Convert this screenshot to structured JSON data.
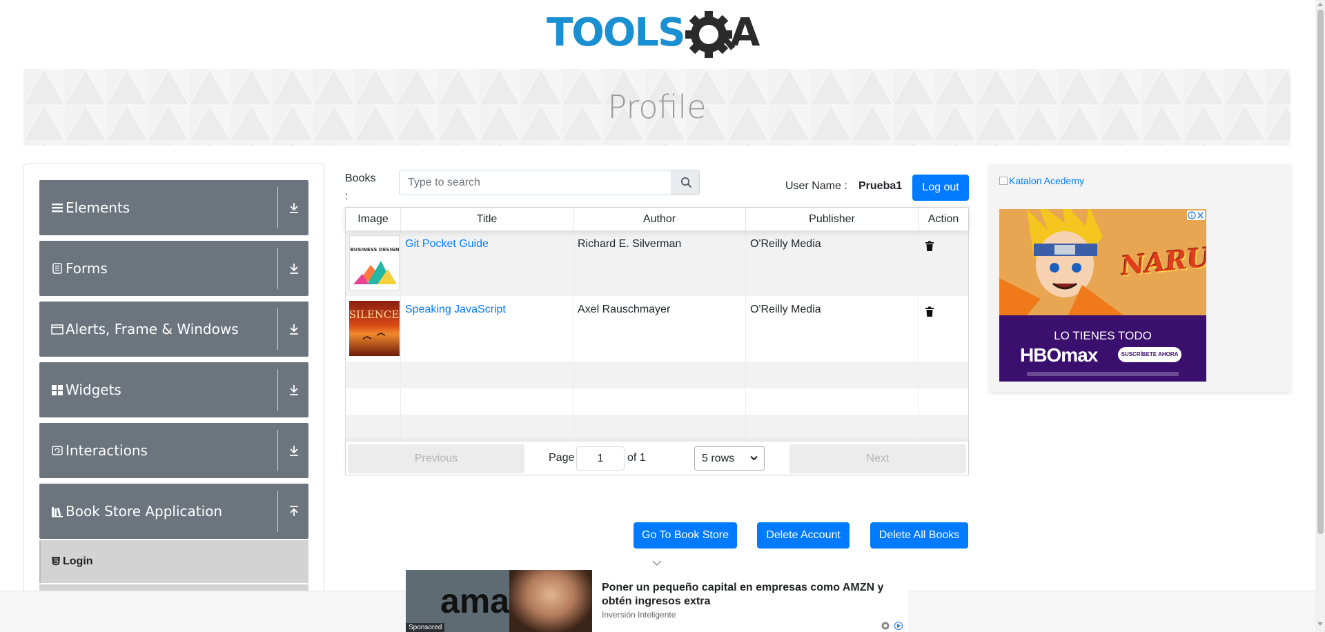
{
  "header": {
    "logo_text_left": "TOOLS",
    "logo_text_right": "A",
    "page_title": "Profile"
  },
  "sidebar": {
    "groups": [
      {
        "label": "Elements",
        "icon": "hamburger-icon"
      },
      {
        "label": "Forms",
        "icon": "document-icon"
      },
      {
        "label": "Alerts, Frame & Windows",
        "icon": "window-icon"
      },
      {
        "label": "Widgets",
        "icon": "widgets-icon"
      },
      {
        "label": "Interactions",
        "icon": "interactions-icon"
      },
      {
        "label": "Book Store Application",
        "icon": "books-icon"
      }
    ],
    "book_store_items": [
      {
        "label": "Login",
        "icon": "html5-icon"
      }
    ]
  },
  "profile": {
    "books_label": "Books :",
    "search_placeholder": "Type to search",
    "user_name_label": "User Name :",
    "user_name_value": "Prueba1",
    "logout_label": "Log out"
  },
  "table": {
    "columns": [
      "Image",
      "Title",
      "Author",
      "Publisher",
      "Action"
    ],
    "rows": [
      {
        "title": "Git Pocket Guide",
        "author": "Richard E. Silverman",
        "publisher": "O'Reilly Media",
        "image_text": "BUSINESS DESIGN"
      },
      {
        "title": "Speaking JavaScript",
        "author": "Axel Rauschmayer",
        "publisher": "O'Reilly Media",
        "image_text": "SILENCE"
      }
    ],
    "pagination": {
      "previous": "Previous",
      "page_label": "Page",
      "page_value": "1",
      "of_label": "of 1",
      "rows_option": "5 rows",
      "next": "Next"
    }
  },
  "actions": {
    "go_to_store": "Go To Book Store",
    "delete_account": "Delete Account",
    "delete_all_books": "Delete All Books"
  },
  "right_ad": {
    "katalon_alt": "Katalon Acedemy",
    "naruto": "NARUTO",
    "tagline": "LO TIENES TODO",
    "brand": "HBOmax",
    "cta": "SUSCRÍBETE AHORA"
  },
  "bottom_ad": {
    "image_text": "amaz",
    "sponsored": "Sponsored",
    "headline": "Poner un pequeño capital en empresas como AMZN y obtén ingresos extra",
    "source": "Inversión Inteligente"
  },
  "colors": {
    "primary": "#007bff",
    "sidebar_group": "#6c757d",
    "logo_blue": "#1a8fd1",
    "logo_dark": "#2b2b2b"
  }
}
